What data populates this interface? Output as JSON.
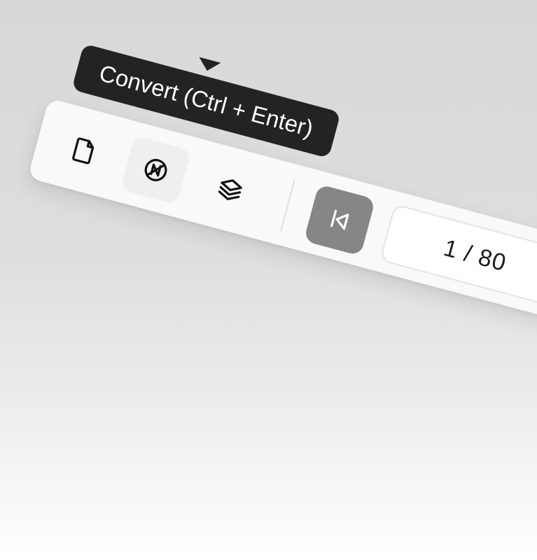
{
  "tooltip": {
    "text": "Convert (Ctrl + Enter)"
  },
  "toolbar": {
    "tools": [
      {
        "name": "file",
        "icon": "file-icon",
        "active": false
      },
      {
        "name": "convert",
        "icon": "convert-icon",
        "active": true
      },
      {
        "name": "layers",
        "icon": "layers-icon",
        "active": false
      }
    ],
    "navigation": {
      "first_page_icon": "skip-to-first-icon",
      "page_indicator": "1 / 80"
    }
  },
  "colors": {
    "tooltip_bg": "#232323",
    "nav_button_bg": "#868686",
    "toolbar_bg": "#f9f9f9",
    "active_tool_bg": "#efefef"
  }
}
